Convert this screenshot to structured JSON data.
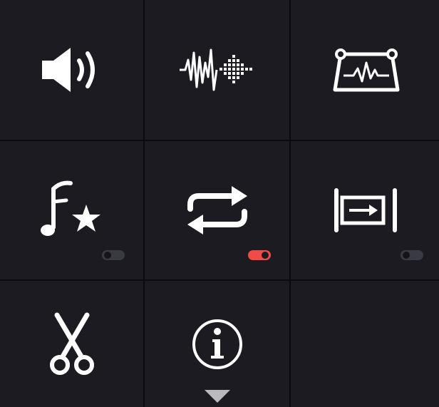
{
  "theme": {
    "tile_bg": "#1c1b22",
    "divider": "#0b0b0f",
    "icon_color": "#ffffff",
    "toggle_on": "#f04b45",
    "toggle_off": "#3a3a42",
    "caret": "#b9b9be"
  },
  "tiles": [
    {
      "icon": "speaker-volume-icon"
    },
    {
      "icon": "waveform-icon"
    },
    {
      "icon": "oscilloscope-icon"
    },
    {
      "icon": "music-note-star-icon",
      "toggle": "off"
    },
    {
      "icon": "repeat-icon",
      "toggle": "on"
    },
    {
      "icon": "skip-to-end-icon",
      "toggle": "off"
    },
    {
      "icon": "scissors-icon"
    },
    {
      "icon": "info-icon",
      "more": "chevron-down-icon"
    },
    {
      "icon": null
    }
  ]
}
